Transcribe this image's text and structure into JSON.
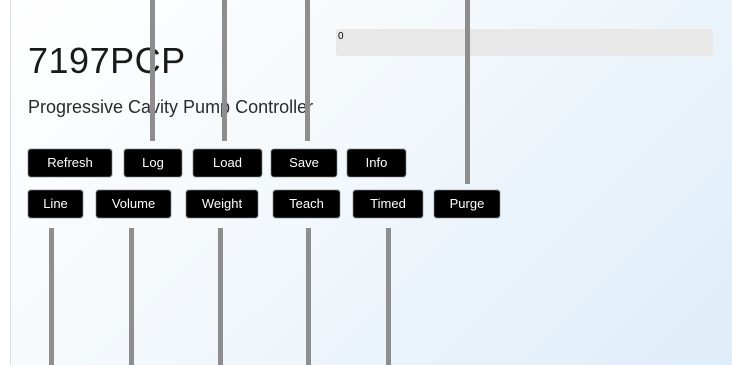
{
  "app": {
    "title": "7197PCP",
    "subtitle": "Progressive Cavity Pump Controller"
  },
  "progress": {
    "value": 0,
    "label": "0"
  },
  "toolbar_row1": {
    "refresh": "Refresh",
    "log": "Log",
    "load": "Load",
    "save": "Save",
    "info": "Info"
  },
  "toolbar_row2": {
    "line": "Line",
    "volume": "Volume",
    "weight": "Weight",
    "teach": "Teach",
    "timed": "Timed",
    "purge": "Purge"
  },
  "colors": {
    "button_bg": "#000000",
    "button_text": "#ffffff",
    "progress_fill": "#8a8a8a",
    "connector": "#8e8e8e"
  }
}
